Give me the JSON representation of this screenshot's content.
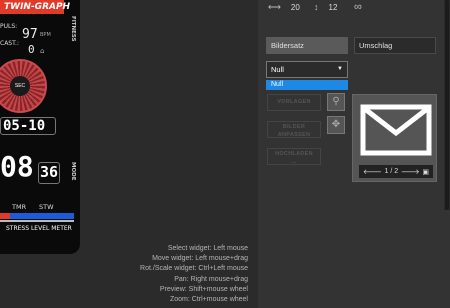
{
  "watch": {
    "brand": "TWIN-GRAPH",
    "pulse_label": "PULS:",
    "pulse_value": "97",
    "pulse_unit": "BPM",
    "cast_label": "CAST.:",
    "cast_value": "0",
    "fitness_label": "FITNESS",
    "dial_label": "SEC",
    "date_value": "05-10",
    "big_time": "08",
    "seconds": "36",
    "mode_label": "MODE",
    "tmr_label": "TMR",
    "stw_label": "STW",
    "stress_label": "STRESS LEVEL METER",
    "colors": {
      "accent": "#e03a2a",
      "dial": "#c0464a",
      "stripe_blue": "#1e5bd8"
    }
  },
  "help_lines": [
    "Select widget: Left mouse",
    "Move widget: Left mouse+drag",
    "Rot./Scale widget: Ctrl+Left mouse",
    "Pan: Right mouse+drag",
    "Preview: Shift+mouse wheel",
    "Zoom: Ctrl+mouse wheel"
  ],
  "panel": {
    "toolbar": {
      "width_icon": "width-arrows-icon",
      "width_value": "20",
      "height_icon": "height-arrows-icon",
      "height_value": "12",
      "link_icon": "chain-link-icon"
    },
    "image_set_field": "Bildersatz",
    "envelope_field": "Umschlag",
    "select_value": "Null",
    "dropdown_option": "Null",
    "buttons": {
      "enlarge": "VORLAGEN",
      "images": [
        "BILDER",
        "ANPASSEN"
      ],
      "upload": [
        "HOCHLADEN",
        "..."
      ]
    },
    "preview_nav": {
      "counter": "1 / 2",
      "prev_icon": "arrow-left-icon",
      "next_icon": "arrow-right-icon",
      "view_icon": "image-view-icon"
    },
    "colors": {
      "dropdown_selected": "#1e88e5",
      "panel_bg": "#333333"
    }
  }
}
